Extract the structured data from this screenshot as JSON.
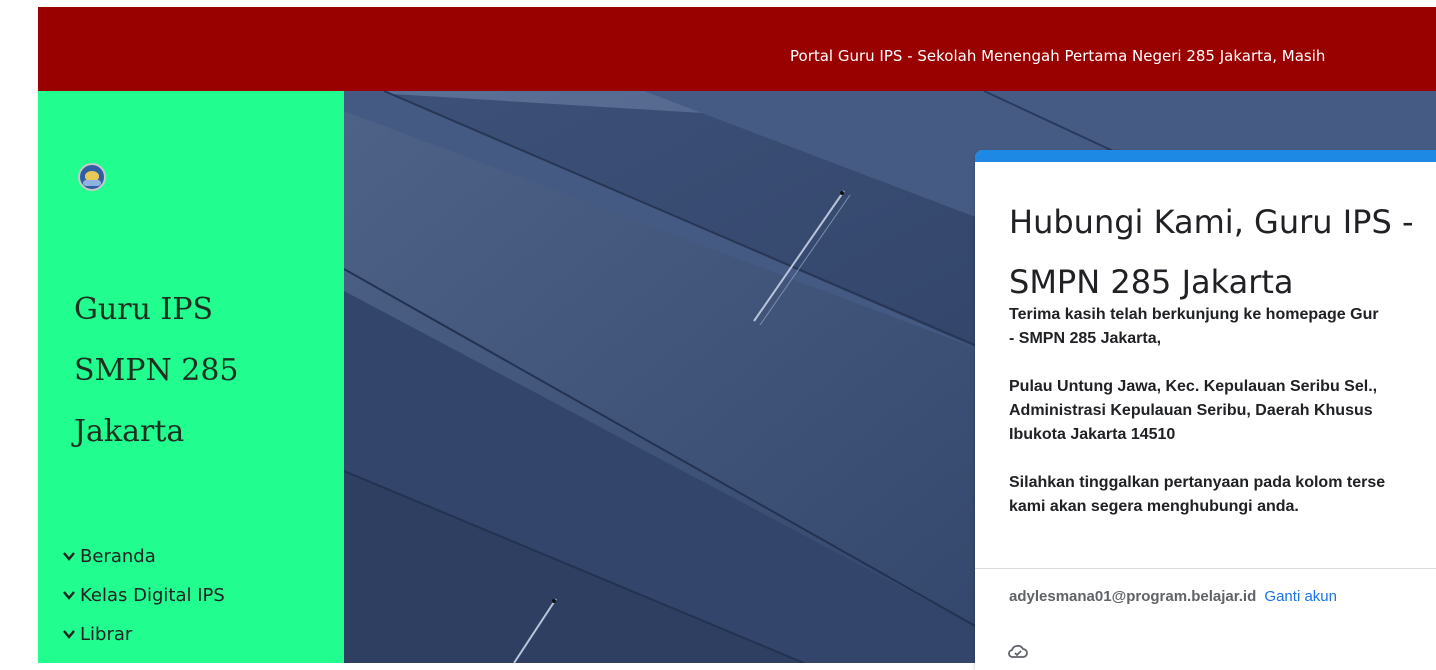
{
  "header": {
    "ticker_text": "Portal Guru IPS - Sekolah Menengah Pertama Negeri 285 Jakarta, Masih"
  },
  "sidebar": {
    "title_lines": [
      "Guru IPS",
      "SMPN 285",
      "Jakarta"
    ],
    "menu": [
      {
        "label": "Beranda",
        "icon": "chevron-down-icon"
      },
      {
        "label": "Kelas Digital IPS",
        "icon": "chevron-down-icon"
      },
      {
        "label": "Librar",
        "icon": "chevron-down-icon"
      }
    ]
  },
  "form": {
    "title_lines": [
      "Hubungi Kami, Guru IPS -",
      "SMPN 285 Jakarta"
    ],
    "description": [
      [
        "Terima kasih telah berkunjung ke homepage Gur",
        "- SMPN 285 Jakarta,"
      ],
      [
        "Pulau Untung Jawa, Kec. Kepulauan Seribu Sel., ",
        "Administrasi Kepulauan Seribu, Daerah Khusus",
        "Ibukota Jakarta 14510"
      ],
      [
        "Silahkan tinggalkan pertanyaan pada kolom terse",
        "kami akan segera menghubungi anda."
      ]
    ],
    "account_email": "adylesmana01@program.belajar.id",
    "switch_account_label": "Ganti akun",
    "cloud_icon": "cloud-check-icon"
  },
  "colors": {
    "header_bg": "#990000",
    "sidebar_bg": "#21fd8f",
    "form_accent": "#1e88e5",
    "link": "#1a73e8"
  }
}
